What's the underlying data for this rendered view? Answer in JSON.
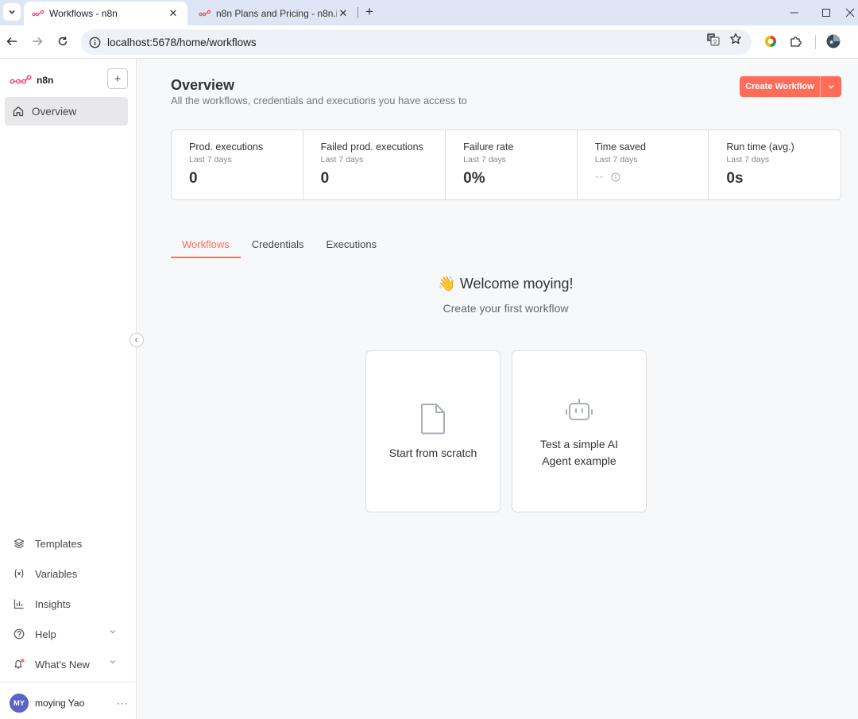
{
  "browser": {
    "tabs": [
      {
        "title": "Workflows - n8n",
        "close": "✕"
      },
      {
        "title": "n8n Plans and Pricing - n8n.i",
        "close": "✕"
      }
    ],
    "new_tab": "+",
    "url": "localhost:5678/home/workflows"
  },
  "sidebar": {
    "logo_text": "n8n",
    "add_label": "+",
    "overview_label": "Overview",
    "bottom_items": [
      {
        "label": "Templates",
        "icon": "templates-icon"
      },
      {
        "label": "Variables",
        "icon": "variables-icon"
      },
      {
        "label": "Insights",
        "icon": "insights-icon"
      },
      {
        "label": "Help",
        "icon": "help-icon"
      },
      {
        "label": "What's New",
        "icon": "bell-icon"
      }
    ],
    "user": {
      "initials": "MY",
      "name": "moying Yao",
      "more": "···"
    }
  },
  "main": {
    "title": "Overview",
    "subtitle": "All the workflows, credentials and executions you have access to",
    "create_button": "Create Workflow",
    "stats": [
      {
        "label": "Prod. executions",
        "period": "Last 7 days",
        "value": "0"
      },
      {
        "label": "Failed prod. executions",
        "period": "Last 7 days",
        "value": "0"
      },
      {
        "label": "Failure rate",
        "period": "Last 7 days",
        "value": "0%"
      },
      {
        "label": "Time saved",
        "period": "Last 7 days",
        "value": "--"
      },
      {
        "label": "Run time (avg.)",
        "period": "Last 7 days",
        "value": "0s"
      }
    ],
    "tabs": [
      "Workflows",
      "Credentials",
      "Executions"
    ],
    "welcome": "👋 Welcome moying!",
    "welcome_sub": "Create your first workflow",
    "cards": [
      {
        "label": "Start from scratch",
        "icon": "file-icon"
      },
      {
        "label": "Test a simple AI Agent example",
        "icon": "robot-icon"
      }
    ]
  },
  "colors": {
    "accent": "#ff6d5a",
    "avatar": "#5b62c8"
  }
}
